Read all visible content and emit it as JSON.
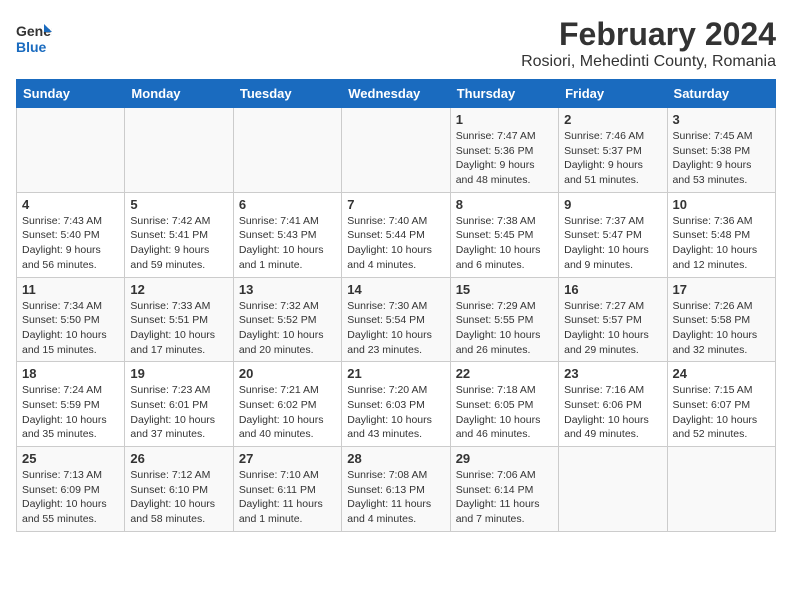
{
  "header": {
    "logo_line1": "General",
    "logo_line2": "Blue",
    "month_year": "February 2024",
    "location": "Rosiori, Mehedinti County, Romania"
  },
  "days_of_week": [
    "Sunday",
    "Monday",
    "Tuesday",
    "Wednesday",
    "Thursday",
    "Friday",
    "Saturday"
  ],
  "weeks": [
    [
      {
        "day": "",
        "info": ""
      },
      {
        "day": "",
        "info": ""
      },
      {
        "day": "",
        "info": ""
      },
      {
        "day": "",
        "info": ""
      },
      {
        "day": "1",
        "info": "Sunrise: 7:47 AM\nSunset: 5:36 PM\nDaylight: 9 hours\nand 48 minutes."
      },
      {
        "day": "2",
        "info": "Sunrise: 7:46 AM\nSunset: 5:37 PM\nDaylight: 9 hours\nand 51 minutes."
      },
      {
        "day": "3",
        "info": "Sunrise: 7:45 AM\nSunset: 5:38 PM\nDaylight: 9 hours\nand 53 minutes."
      }
    ],
    [
      {
        "day": "4",
        "info": "Sunrise: 7:43 AM\nSunset: 5:40 PM\nDaylight: 9 hours\nand 56 minutes."
      },
      {
        "day": "5",
        "info": "Sunrise: 7:42 AM\nSunset: 5:41 PM\nDaylight: 9 hours\nand 59 minutes."
      },
      {
        "day": "6",
        "info": "Sunrise: 7:41 AM\nSunset: 5:43 PM\nDaylight: 10 hours\nand 1 minute."
      },
      {
        "day": "7",
        "info": "Sunrise: 7:40 AM\nSunset: 5:44 PM\nDaylight: 10 hours\nand 4 minutes."
      },
      {
        "day": "8",
        "info": "Sunrise: 7:38 AM\nSunset: 5:45 PM\nDaylight: 10 hours\nand 6 minutes."
      },
      {
        "day": "9",
        "info": "Sunrise: 7:37 AM\nSunset: 5:47 PM\nDaylight: 10 hours\nand 9 minutes."
      },
      {
        "day": "10",
        "info": "Sunrise: 7:36 AM\nSunset: 5:48 PM\nDaylight: 10 hours\nand 12 minutes."
      }
    ],
    [
      {
        "day": "11",
        "info": "Sunrise: 7:34 AM\nSunset: 5:50 PM\nDaylight: 10 hours\nand 15 minutes."
      },
      {
        "day": "12",
        "info": "Sunrise: 7:33 AM\nSunset: 5:51 PM\nDaylight: 10 hours\nand 17 minutes."
      },
      {
        "day": "13",
        "info": "Sunrise: 7:32 AM\nSunset: 5:52 PM\nDaylight: 10 hours\nand 20 minutes."
      },
      {
        "day": "14",
        "info": "Sunrise: 7:30 AM\nSunset: 5:54 PM\nDaylight: 10 hours\nand 23 minutes."
      },
      {
        "day": "15",
        "info": "Sunrise: 7:29 AM\nSunset: 5:55 PM\nDaylight: 10 hours\nand 26 minutes."
      },
      {
        "day": "16",
        "info": "Sunrise: 7:27 AM\nSunset: 5:57 PM\nDaylight: 10 hours\nand 29 minutes."
      },
      {
        "day": "17",
        "info": "Sunrise: 7:26 AM\nSunset: 5:58 PM\nDaylight: 10 hours\nand 32 minutes."
      }
    ],
    [
      {
        "day": "18",
        "info": "Sunrise: 7:24 AM\nSunset: 5:59 PM\nDaylight: 10 hours\nand 35 minutes."
      },
      {
        "day": "19",
        "info": "Sunrise: 7:23 AM\nSunset: 6:01 PM\nDaylight: 10 hours\nand 37 minutes."
      },
      {
        "day": "20",
        "info": "Sunrise: 7:21 AM\nSunset: 6:02 PM\nDaylight: 10 hours\nand 40 minutes."
      },
      {
        "day": "21",
        "info": "Sunrise: 7:20 AM\nSunset: 6:03 PM\nDaylight: 10 hours\nand 43 minutes."
      },
      {
        "day": "22",
        "info": "Sunrise: 7:18 AM\nSunset: 6:05 PM\nDaylight: 10 hours\nand 46 minutes."
      },
      {
        "day": "23",
        "info": "Sunrise: 7:16 AM\nSunset: 6:06 PM\nDaylight: 10 hours\nand 49 minutes."
      },
      {
        "day": "24",
        "info": "Sunrise: 7:15 AM\nSunset: 6:07 PM\nDaylight: 10 hours\nand 52 minutes."
      }
    ],
    [
      {
        "day": "25",
        "info": "Sunrise: 7:13 AM\nSunset: 6:09 PM\nDaylight: 10 hours\nand 55 minutes."
      },
      {
        "day": "26",
        "info": "Sunrise: 7:12 AM\nSunset: 6:10 PM\nDaylight: 10 hours\nand 58 minutes."
      },
      {
        "day": "27",
        "info": "Sunrise: 7:10 AM\nSunset: 6:11 PM\nDaylight: 11 hours\nand 1 minute."
      },
      {
        "day": "28",
        "info": "Sunrise: 7:08 AM\nSunset: 6:13 PM\nDaylight: 11 hours\nand 4 minutes."
      },
      {
        "day": "29",
        "info": "Sunrise: 7:06 AM\nSunset: 6:14 PM\nDaylight: 11 hours\nand 7 minutes."
      },
      {
        "day": "",
        "info": ""
      },
      {
        "day": "",
        "info": ""
      }
    ]
  ]
}
